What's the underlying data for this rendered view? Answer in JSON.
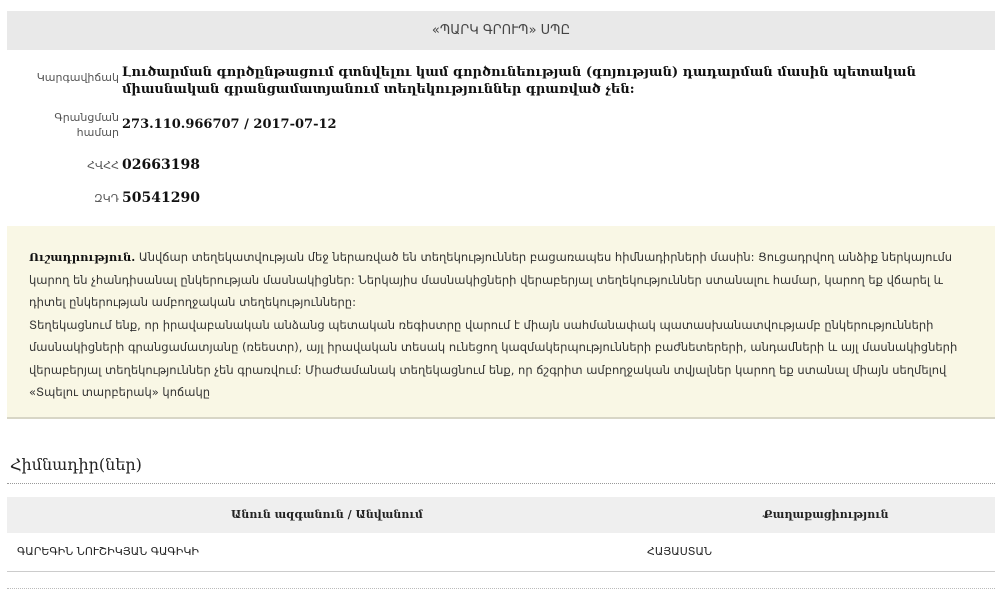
{
  "header": {
    "company_title": "«ՊԱՐԿ ԳՐՈՒՊ» ՍՊԸ"
  },
  "info": {
    "status_label": "Կարգավիճակ",
    "status_value": "Լուծարման գործընթացում գտնվելու կամ գործունեության (գոյության) դադարման մասին պետական միասնական գրանցամատյանում տեղեկություններ գրառված չեն:",
    "reg_label": "Գրանցման համար",
    "reg_value": "273.110.966707 / 2017-07-12",
    "tin_label": "ՀՎՀՀ",
    "tin_value": "02663198",
    "ssn_label": "ԶԿԴ",
    "ssn_value": "50541290"
  },
  "notice": {
    "heading": "Ուշադրություն.",
    "text1": "Անվճար տեղեկատվության մեջ ներառված են տեղեկություններ բացառապես հիմնադիրների մասին: Ցուցադրվող անձիք ներկայումս կարող են չհանդիսանալ ընկերության մասնակիցներ: Ներկայիս մասնակիցների վերաբերյալ տեղեկություններ ստանալու համար, կարող եք վճարել և դիտել ընկերության ամբողջական տեղեկությունները:",
    "text2": "Տեղեկացնում ենք, որ իրավաբանական անձանց պետական ռեգիստրը վարում է միայն սահմանափակ պատասխանատվությամբ ընկերությունների մասնակիցների գրանցամատյանը (ռեեստր), այլ իրավական տեսակ ունեցող կազմակերպությունների բաժնետերերի, անդամների և այլ մասնակիցների վերաբերյալ տեղեկություններ չեն գրառվում: Միաժամանակ տեղեկացնում ենք, որ ճշգրիտ ամբողջական տվյալներ կարող եք ստանալ միայն սեղմելով «Տպելու տարբերակ» կոճակը"
  },
  "founders": {
    "section_title": "Հիմնադիր(ներ)",
    "col_name": "Անուն ազգանուն / Անվանում",
    "col_citizenship": "Քաղաքացիություն",
    "rows": [
      {
        "name": "ԳԱՐԵԳԻՆ ՆՈՒՇԻԿՅԱՆ ԳԱԳԻԿԻ",
        "citizenship": "ՀԱՅԱՍՏԱՆ"
      }
    ]
  }
}
